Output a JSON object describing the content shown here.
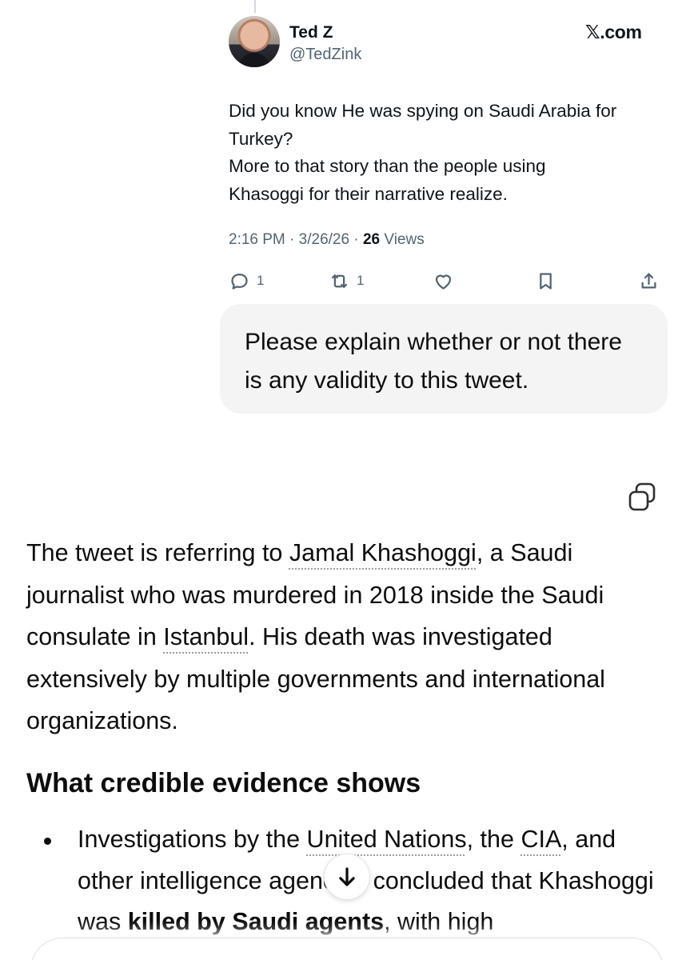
{
  "tweet": {
    "author_name": "Ted Z",
    "author_handle": "@TedZink",
    "source": "𝕏.com",
    "text_lines": [
      "Did you know He was spying on Saudi Arabia for",
      "Turkey?",
      "More to that story than the people using",
      "Khasoggi for their narrative realize."
    ],
    "time": "2:16 PM",
    "date": "3/26/26",
    "views_count": "26",
    "views_label": "Views",
    "reply_count": "1",
    "repost_count": "1"
  },
  "user_message": "Please explain whether or not there is any validity to this tweet.",
  "answer": {
    "intro_parts": [
      "The tweet is referring to ",
      "Jamal Khashoggi",
      ", a Saudi journalist who was murdered in 2018 inside the Saudi consulate in ",
      "Istanbul",
      ". His death was investigated extensively by multiple governments and international organizations."
    ],
    "heading": "What credible evidence shows",
    "bullet1": {
      "parts": [
        "Investigations by the ",
        "United Nations",
        ", the ",
        "CIA",
        ", and other intelligence agencies concluded that Khashoggi was ",
        "killed by Saudi agents",
        ", with high"
      ]
    }
  },
  "colors": {
    "text_primary": "#0d0d0d",
    "tweet_secondary": "#536471",
    "bubble_bg": "#f4f4f4"
  },
  "icons": {
    "reply": "reply-icon",
    "repost": "repost-icon",
    "like": "heart-icon",
    "bookmark": "bookmark-icon",
    "share": "share-icon",
    "copy": "copy-icon",
    "scroll": "arrow-down-icon"
  }
}
